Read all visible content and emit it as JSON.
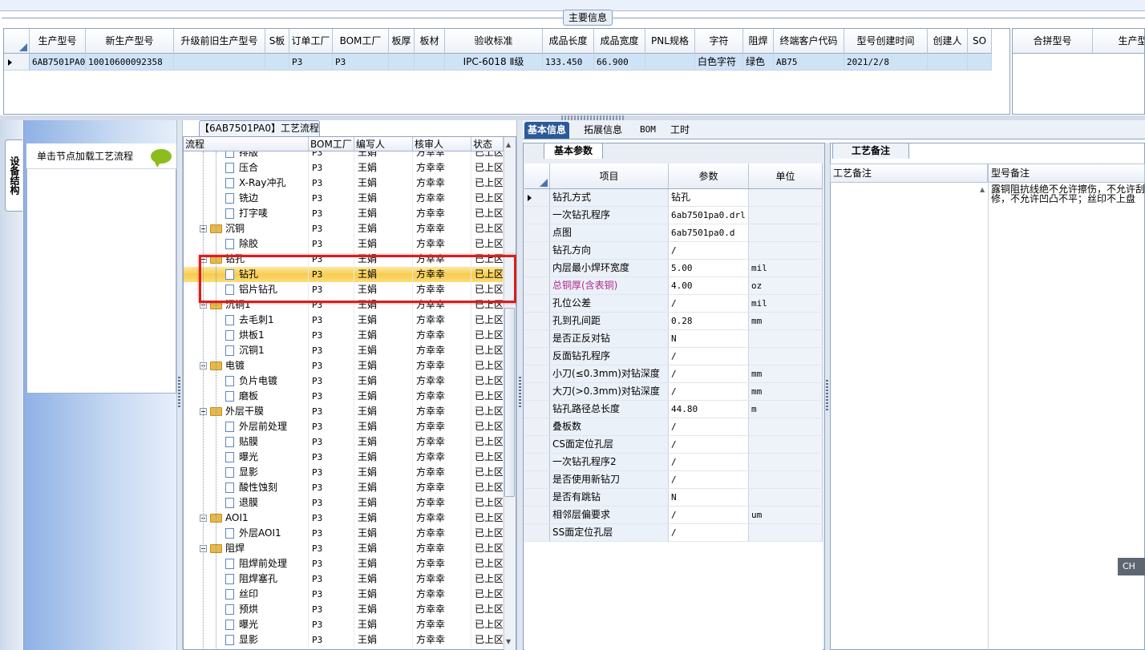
{
  "main_info": {
    "title": "主要信息",
    "columns": [
      "生产型号",
      "新生产型号",
      "升级前旧生产型号",
      "S板",
      "订单工厂",
      "BOM工厂",
      "板厚",
      "板材",
      "验收标准",
      "成品长度",
      "成品宽度",
      "PNL规格",
      "字符",
      "阻焊",
      "终端客户代码",
      "型号创建时间",
      "创建人",
      "SO"
    ],
    "row": [
      "6AB7501PA0",
      "10010600092358",
      "",
      "",
      "P3",
      "P3",
      "",
      "",
      "IPC-6018 Ⅱ级",
      "133.450",
      "66.900",
      "",
      "白色字符",
      "绿色",
      "AB75",
      "2021/2/8",
      "",
      ""
    ],
    "side_columns": [
      "合拼型号",
      "生产型"
    ]
  },
  "left_panel": {
    "vertical_tab": "设备结构",
    "card_label": "单击节点加载工艺流程"
  },
  "process_tree": {
    "title": "【6AB7501PA0】工艺流程",
    "columns": [
      "流程",
      "BOM工厂",
      "编写人",
      "核审人",
      "状态"
    ],
    "rows": [
      {
        "name": "排版",
        "type": "doc",
        "bom": "P3",
        "writer": "王娟",
        "reviewer": "方幸幸",
        "status": "已上区"
      },
      {
        "name": "压合",
        "type": "doc",
        "bom": "P3",
        "writer": "王娟",
        "reviewer": "方幸幸",
        "status": "已上区"
      },
      {
        "name": "X-Ray冲孔",
        "type": "doc",
        "bom": "P3",
        "writer": "王娟",
        "reviewer": "方幸幸",
        "status": "已上区"
      },
      {
        "name": "铣边",
        "type": "doc",
        "bom": "P3",
        "writer": "王娟",
        "reviewer": "方幸幸",
        "status": "已上区"
      },
      {
        "name": "打字唛",
        "type": "doc",
        "bom": "P3",
        "writer": "王娟",
        "reviewer": "方幸幸",
        "status": "已上区"
      },
      {
        "name": "沉铜",
        "type": "folder",
        "bom": "P3",
        "writer": "王娟",
        "reviewer": "方幸幸",
        "status": "已上区"
      },
      {
        "name": "除胶",
        "type": "doc",
        "bom": "P3",
        "writer": "王娟",
        "reviewer": "方幸幸",
        "status": "已上区"
      },
      {
        "name": "钻孔",
        "type": "folder",
        "bom": "P3",
        "writer": "王娟",
        "reviewer": "方幸幸",
        "status": "已上区"
      },
      {
        "name": "钻孔",
        "type": "doc",
        "bom": "P3",
        "writer": "王娟",
        "reviewer": "方幸幸",
        "status": "已上区",
        "selected": true
      },
      {
        "name": "铝片钻孔",
        "type": "doc",
        "bom": "P3",
        "writer": "王娟",
        "reviewer": "方幸幸",
        "status": "已上区"
      },
      {
        "name": "沉铜1",
        "type": "folder",
        "bom": "P3",
        "writer": "王娟",
        "reviewer": "方幸幸",
        "status": "已上区"
      },
      {
        "name": "去毛刺1",
        "type": "doc",
        "bom": "P3",
        "writer": "王娟",
        "reviewer": "方幸幸",
        "status": "已上区"
      },
      {
        "name": "烘板1",
        "type": "doc",
        "bom": "P3",
        "writer": "王娟",
        "reviewer": "方幸幸",
        "status": "已上区"
      },
      {
        "name": "沉铜1",
        "type": "doc",
        "bom": "P3",
        "writer": "王娟",
        "reviewer": "方幸幸",
        "status": "已上区"
      },
      {
        "name": "电镀",
        "type": "folder",
        "bom": "P3",
        "writer": "王娟",
        "reviewer": "方幸幸",
        "status": "已上区"
      },
      {
        "name": "负片电镀",
        "type": "doc",
        "bom": "P3",
        "writer": "王娟",
        "reviewer": "方幸幸",
        "status": "已上区"
      },
      {
        "name": "磨板",
        "type": "doc",
        "bom": "P3",
        "writer": "王娟",
        "reviewer": "方幸幸",
        "status": "已上区"
      },
      {
        "name": "外层干膜",
        "type": "folder",
        "bom": "P3",
        "writer": "王娟",
        "reviewer": "方幸幸",
        "status": "已上区"
      },
      {
        "name": "外层前处理",
        "type": "doc",
        "bom": "P3",
        "writer": "王娟",
        "reviewer": "方幸幸",
        "status": "已上区"
      },
      {
        "name": "贴膜",
        "type": "doc",
        "bom": "P3",
        "writer": "王娟",
        "reviewer": "方幸幸",
        "status": "已上区"
      },
      {
        "name": "曝光",
        "type": "doc",
        "bom": "P3",
        "writer": "王娟",
        "reviewer": "方幸幸",
        "status": "已上区"
      },
      {
        "name": "显影",
        "type": "doc",
        "bom": "P3",
        "writer": "王娟",
        "reviewer": "方幸幸",
        "status": "已上区"
      },
      {
        "name": "酸性蚀刻",
        "type": "doc",
        "bom": "P3",
        "writer": "王娟",
        "reviewer": "方幸幸",
        "status": "已上区"
      },
      {
        "name": "退膜",
        "type": "doc",
        "bom": "P3",
        "writer": "王娟",
        "reviewer": "方幸幸",
        "status": "已上区"
      },
      {
        "name": "AOI1",
        "type": "folder",
        "bom": "P3",
        "writer": "王娟",
        "reviewer": "方幸幸",
        "status": "已上区"
      },
      {
        "name": "外层AOI1",
        "type": "doc",
        "bom": "P3",
        "writer": "王娟",
        "reviewer": "方幸幸",
        "status": "已上区"
      },
      {
        "name": "阻焊",
        "type": "folder",
        "bom": "P3",
        "writer": "王娟",
        "reviewer": "方幸幸",
        "status": "已上区"
      },
      {
        "name": "阻焊前处理",
        "type": "doc",
        "bom": "P3",
        "writer": "王娟",
        "reviewer": "方幸幸",
        "status": "已上区"
      },
      {
        "name": "阻焊塞孔",
        "type": "doc",
        "bom": "P3",
        "writer": "王娟",
        "reviewer": "方幸幸",
        "status": "已上区"
      },
      {
        "name": "丝印",
        "type": "doc",
        "bom": "P3",
        "writer": "王娟",
        "reviewer": "方幸幸",
        "status": "已上区"
      },
      {
        "name": "预烘",
        "type": "doc",
        "bom": "P3",
        "writer": "王娟",
        "reviewer": "方幸幸",
        "status": "已上区"
      },
      {
        "name": "曝光",
        "type": "doc",
        "bom": "P3",
        "writer": "王娟",
        "reviewer": "方幸幸",
        "status": "已上区"
      },
      {
        "name": "显影",
        "type": "doc",
        "bom": "P3",
        "writer": "王娟",
        "reviewer": "方幸幸",
        "status": "已上区"
      }
    ]
  },
  "right_tabs": [
    "基本信息",
    "拓展信息",
    "BOM",
    "工时"
  ],
  "params": {
    "tab": "基本参数",
    "columns": [
      "项目",
      "参数",
      "单位"
    ],
    "rows": [
      {
        "item": "钻孔方式",
        "value": "钻孔",
        "unit": "",
        "current": true
      },
      {
        "item": "一次钻孔程序",
        "value": "6ab7501pa0.drl",
        "unit": ""
      },
      {
        "item": "点图",
        "value": "6ab7501pa0.d",
        "unit": ""
      },
      {
        "item": "钻孔方向",
        "value": "/",
        "unit": ""
      },
      {
        "item": "内层最小焊环宽度",
        "value": "5.00",
        "unit": "mil"
      },
      {
        "item": "总铜厚(含表铜)",
        "value": "4.00",
        "unit": "oz",
        "highlight": true
      },
      {
        "item": "孔位公差",
        "value": "/",
        "unit": "mil"
      },
      {
        "item": "孔到孔间距",
        "value": "0.28",
        "unit": "mm"
      },
      {
        "item": "是否正反对钻",
        "value": "N",
        "unit": ""
      },
      {
        "item": "反面钻孔程序",
        "value": "/",
        "unit": ""
      },
      {
        "item": "小刀(≤0.3mm)对钻深度",
        "value": "/",
        "unit": "mm"
      },
      {
        "item": "大刀(>0.3mm)对钻深度",
        "value": "/",
        "unit": "mm"
      },
      {
        "item": "钻孔路径总长度",
        "value": "44.80",
        "unit": "m"
      },
      {
        "item": "叠板数",
        "value": "/",
        "unit": ""
      },
      {
        "item": "CS面定位孔层",
        "value": "/",
        "unit": ""
      },
      {
        "item": "一次钻孔程序2",
        "value": "/",
        "unit": ""
      },
      {
        "item": "是否使用新钻刀",
        "value": "/",
        "unit": ""
      },
      {
        "item": "是否有跳钻",
        "value": "N",
        "unit": ""
      },
      {
        "item": "相邻层偏要求",
        "value": "/",
        "unit": "um"
      },
      {
        "item": "SS面定位孔层",
        "value": "/",
        "unit": ""
      }
    ],
    "highlight_color": "#b0288a"
  },
  "remarks": {
    "tab": "工艺备注",
    "col1": "工艺备注",
    "col2": "型号备注",
    "text": "露铜阻抗线绝不允许擦伤，不允许刮修，不允许凹凸不平；丝印不上盘"
  },
  "ch_button": "CH"
}
